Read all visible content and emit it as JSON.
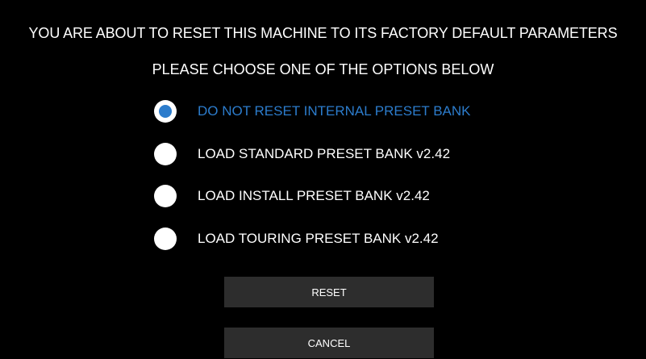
{
  "dialog": {
    "title": "YOU ARE ABOUT TO RESET THIS MACHINE TO ITS FACTORY DEFAULT PARAMETERS",
    "subtitle": "PLEASE CHOOSE ONE OF THE OPTIONS BELOW"
  },
  "options": [
    {
      "label": "DO NOT RESET INTERNAL PRESET BANK",
      "selected": true
    },
    {
      "label": "LOAD STANDARD PRESET BANK v2.42",
      "selected": false
    },
    {
      "label": "LOAD INSTALL PRESET BANK v2.42",
      "selected": false
    },
    {
      "label": "LOAD TOURING PRESET BANK v2.42",
      "selected": false
    }
  ],
  "buttons": {
    "reset_label": "RESET",
    "cancel_label": "CANCEL"
  },
  "colors": {
    "background": "#000000",
    "text": "#ffffff",
    "accent": "#2c7ccc",
    "button": "#2d2d2d"
  }
}
